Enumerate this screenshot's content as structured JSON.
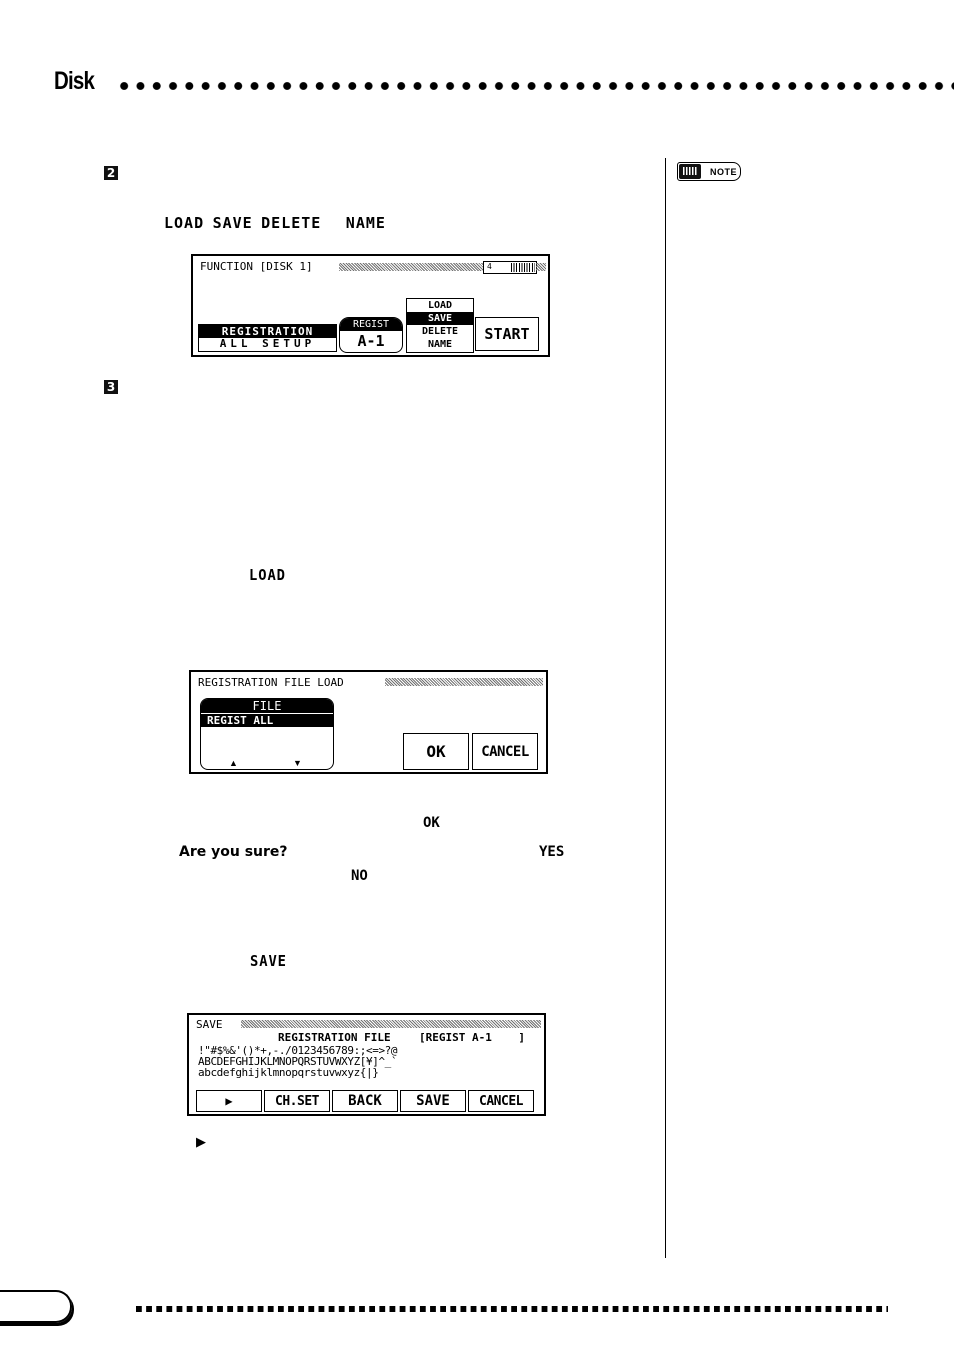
{
  "header": {
    "section_title": "Disk"
  },
  "steps": [
    {
      "number": "2"
    },
    {
      "number": "3"
    }
  ],
  "operation_labels": [
    "LOAD",
    "SAVE",
    "DELETE",
    "NAME"
  ],
  "screen_function": {
    "title": "FUNCTION [DISK 1]",
    "page_indicator": "4",
    "mode_options": [
      "REGISTRATION",
      "ALL SETUP"
    ],
    "selected_mode": "REGISTRATION",
    "regist_label": "REGIST",
    "regist_value": "A-1",
    "operations": [
      "LOAD",
      "SAVE",
      "DELETE",
      "NAME"
    ],
    "selected_operation": "SAVE",
    "start_label": "START"
  },
  "load_heading": "LOAD",
  "screen_load": {
    "title": "REGISTRATION FILE LOAD",
    "file_header": "FILE",
    "file_selected": "REGIST ALL",
    "scroll_up": "▲",
    "scroll_down": "▼",
    "ok_label": "OK",
    "cancel_label": "CANCEL"
  },
  "confirm_text": {
    "ok": "OK",
    "prompt": "Are you sure?",
    "yes": "YES",
    "no": "NO"
  },
  "save_heading": "SAVE",
  "screen_save": {
    "title": "SAVE",
    "filename_label": "REGISTRATION FILE",
    "filename_value": "[REGIST A-1    ]",
    "charset_rows": [
      "!\"#$%&'()*+,-./0123456789:;<=>?@",
      "ABCDEFGHIJKLMNOPQRSTUVWXYZ[¥]^_`",
      "abcdefghijklmnopqrstuvwxyz{|}"
    ],
    "buttons": [
      "▶",
      "CH.SET",
      "BACK",
      "SAVE",
      "CANCEL"
    ]
  },
  "arrow_note": "▶",
  "sidebar": {
    "note_label": "NOTE"
  }
}
